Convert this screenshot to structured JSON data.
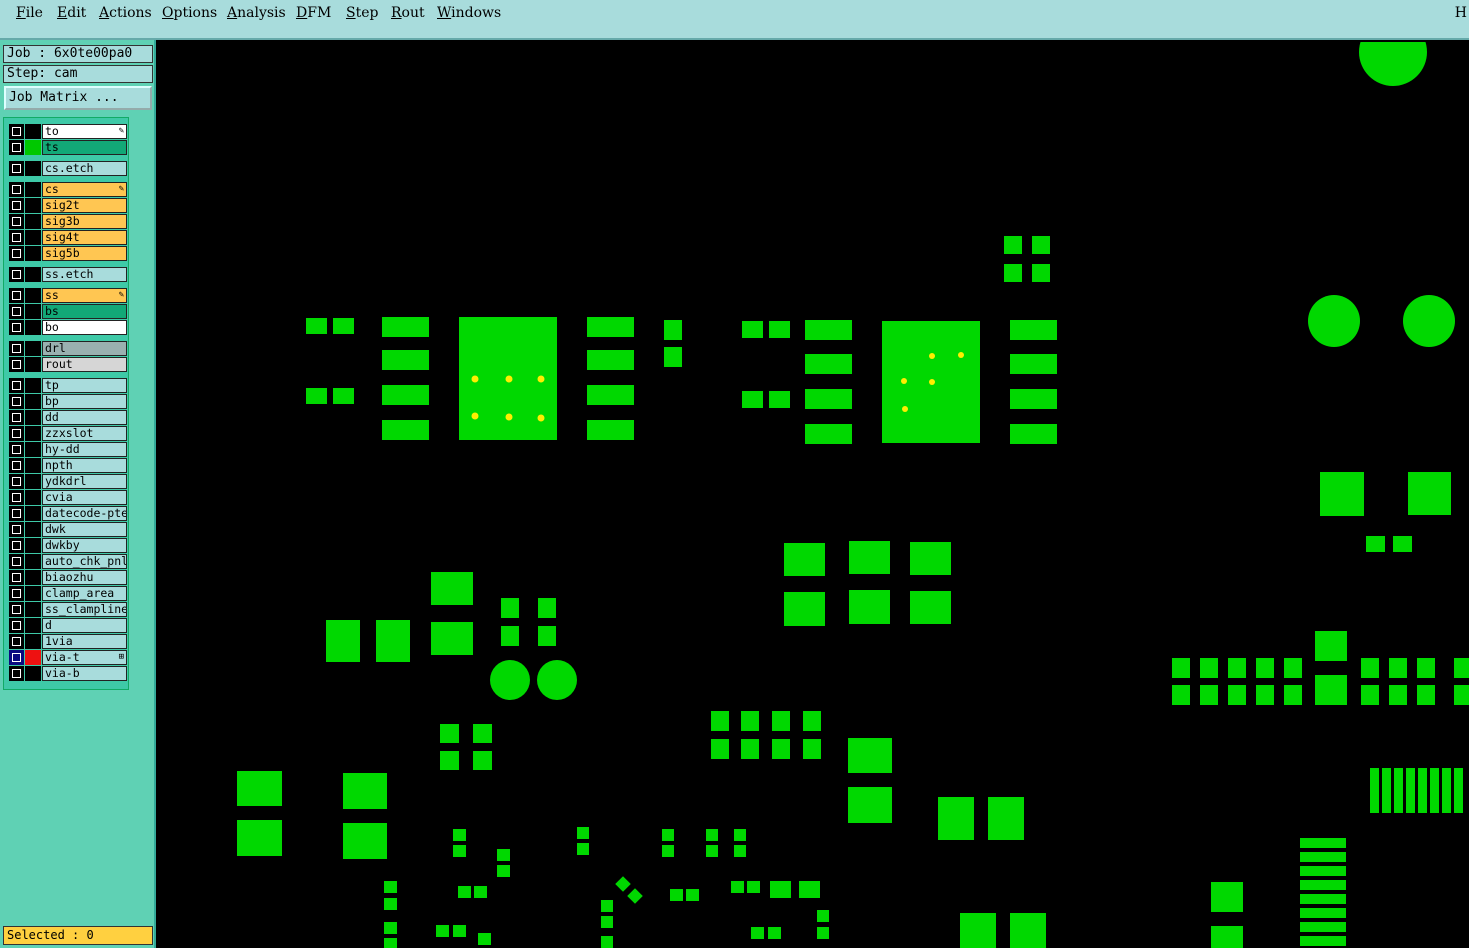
{
  "menu": {
    "items": [
      "File",
      "Edit",
      "Actions",
      "Options",
      "Analysis",
      "DFM",
      "Step",
      "Rout",
      "Windows"
    ],
    "right_label": "H"
  },
  "job": {
    "label": "Job : 6x0te00pa0"
  },
  "step": {
    "label": "Step: cam"
  },
  "job_matrix_button": "Job Matrix ...",
  "layers": [
    {
      "name": "to",
      "bg": "#ffffff",
      "swatch": "#000000",
      "mark": "pencil"
    },
    {
      "name": "ts",
      "bg": "#12a877",
      "swatch": "#00c800",
      "mark": ""
    },
    {
      "name": "cs.etch",
      "bg": "#a8dcdc",
      "swatch": "#000000",
      "mark": ""
    },
    {
      "name": "cs",
      "bg": "#ffc652",
      "swatch": "#000000",
      "mark": "pencil"
    },
    {
      "name": "sig2t",
      "bg": "#ffc652",
      "swatch": "#000000",
      "mark": ""
    },
    {
      "name": "sig3b",
      "bg": "#ffc652",
      "swatch": "#000000",
      "mark": ""
    },
    {
      "name": "sig4t",
      "bg": "#ffc652",
      "swatch": "#000000",
      "mark": ""
    },
    {
      "name": "sig5b",
      "bg": "#ffc652",
      "swatch": "#000000",
      "mark": ""
    },
    {
      "name": "ss.etch",
      "bg": "#a8dcdc",
      "swatch": "#000000",
      "mark": ""
    },
    {
      "name": "ss",
      "bg": "#ffc652",
      "swatch": "#000000",
      "mark": "pencil"
    },
    {
      "name": "bs",
      "bg": "#12a877",
      "swatch": "#000000",
      "mark": ""
    },
    {
      "name": "bo",
      "bg": "#ffffff",
      "swatch": "#000000",
      "mark": ""
    },
    {
      "name": "drl",
      "bg": "#9ab0b0",
      "swatch": "#000000",
      "mark": ""
    },
    {
      "name": "rout",
      "bg": "#d6d6d6",
      "swatch": "#000000",
      "mark": ""
    },
    {
      "name": "tp",
      "bg": "#a8dcdc",
      "swatch": "#000000",
      "mark": ""
    },
    {
      "name": "bp",
      "bg": "#a8dcdc",
      "swatch": "#000000",
      "mark": ""
    },
    {
      "name": "dd",
      "bg": "#a8dcdc",
      "swatch": "#000000",
      "mark": ""
    },
    {
      "name": "zzxslot",
      "bg": "#a8dcdc",
      "swatch": "#000000",
      "mark": ""
    },
    {
      "name": "hy-dd",
      "bg": "#a8dcdc",
      "swatch": "#000000",
      "mark": ""
    },
    {
      "name": "npth",
      "bg": "#a8dcdc",
      "swatch": "#000000",
      "mark": ""
    },
    {
      "name": "ydkdrl",
      "bg": "#a8dcdc",
      "swatch": "#000000",
      "mark": ""
    },
    {
      "name": "cvia",
      "bg": "#a8dcdc",
      "swatch": "#000000",
      "mark": ""
    },
    {
      "name": "datecode-pte",
      "bg": "#a8dcdc",
      "swatch": "#000000",
      "mark": ""
    },
    {
      "name": "dwk",
      "bg": "#a8dcdc",
      "swatch": "#000000",
      "mark": ""
    },
    {
      "name": "dwkby",
      "bg": "#a8dcdc",
      "swatch": "#000000",
      "mark": ""
    },
    {
      "name": "auto_chk_pnl",
      "bg": "#a8dcdc",
      "swatch": "#000000",
      "mark": ""
    },
    {
      "name": "biaozhu",
      "bg": "#a8dcdc",
      "swatch": "#000000",
      "mark": ""
    },
    {
      "name": "clamp_area",
      "bg": "#a8dcdc",
      "swatch": "#000000",
      "mark": ""
    },
    {
      "name": "ss_clampline",
      "bg": "#a8dcdc",
      "swatch": "#000000",
      "mark": ""
    },
    {
      "name": "d",
      "bg": "#a8dcdc",
      "swatch": "#000000",
      "mark": ""
    },
    {
      "name": "1via",
      "bg": "#a8dcdc",
      "swatch": "#000000",
      "mark": ""
    },
    {
      "name": "via-t",
      "bg": "#a8dcdc",
      "swatch": "#ee1111",
      "mark": "grid",
      "checkbox": "#0a0a80"
    },
    {
      "name": "via-b",
      "bg": "#a8dcdc",
      "swatch": "#000000",
      "mark": ""
    }
  ],
  "status": {
    "selected": "Selected : 0"
  },
  "colors": {
    "pad": "#00d800",
    "drill": "#ffee00",
    "background": "#000000"
  }
}
